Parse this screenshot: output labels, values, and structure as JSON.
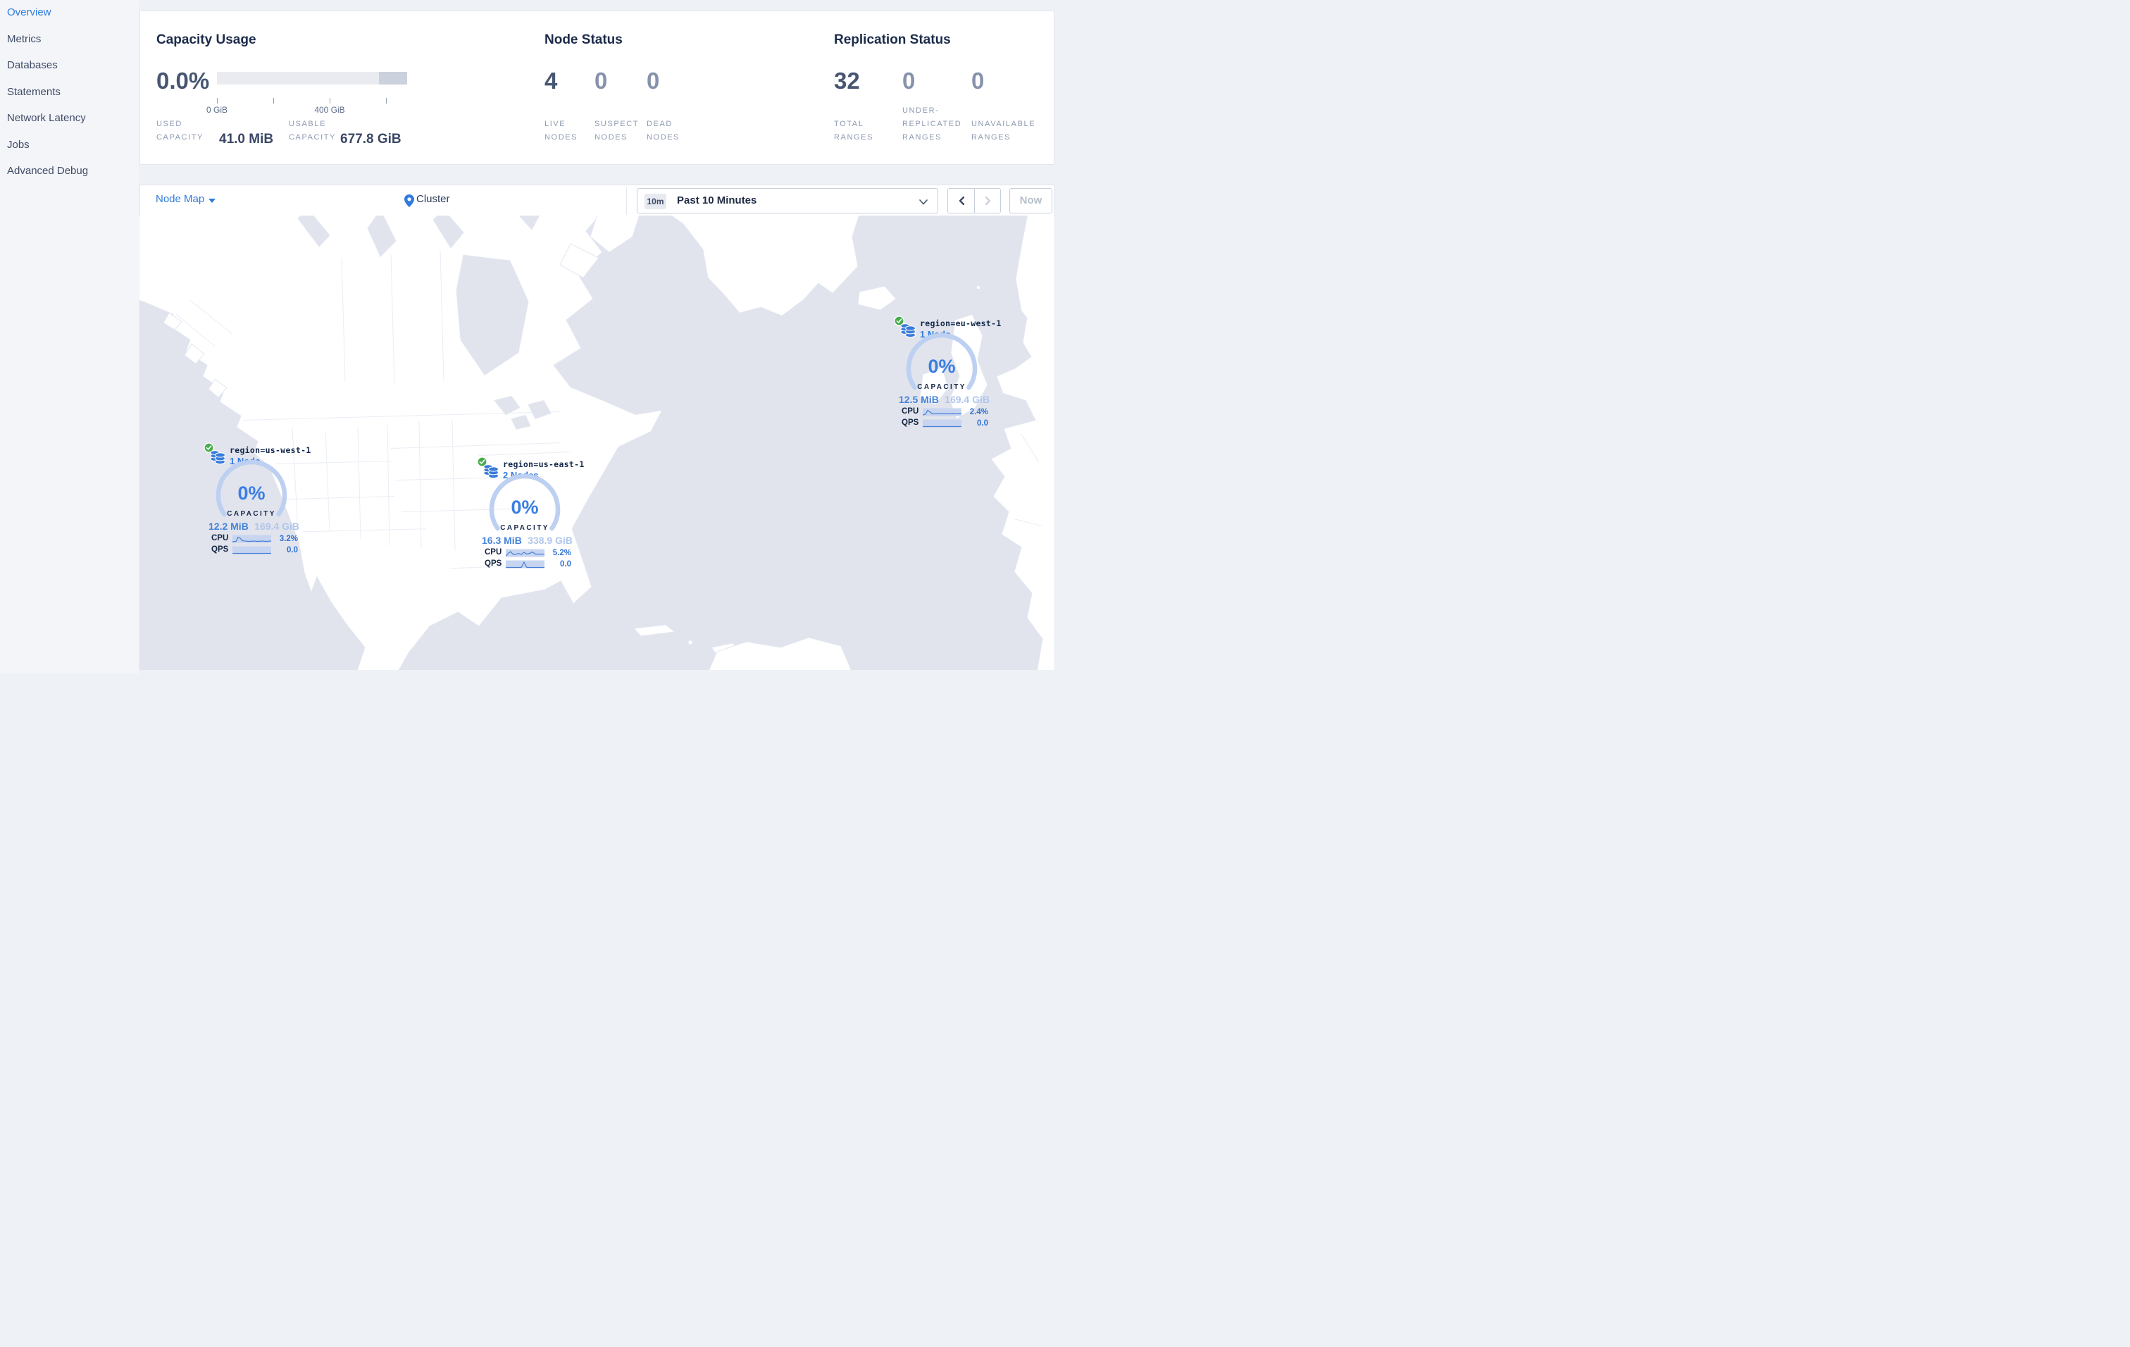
{
  "sidebar": {
    "items": [
      {
        "label": "Overview",
        "active": true
      },
      {
        "label": "Metrics"
      },
      {
        "label": "Databases"
      },
      {
        "label": "Statements"
      },
      {
        "label": "Network Latency"
      },
      {
        "label": "Jobs"
      },
      {
        "label": "Advanced Debug"
      }
    ]
  },
  "capacity": {
    "title": "Capacity Usage",
    "percent": "0.0%",
    "tick_start": "0 GiB",
    "tick_mid": "400 GiB",
    "used_label": "USED CAPACITY",
    "used_value": "41.0 MiB",
    "usable_label": "USABLE CAPACITY",
    "usable_value": "677.8 GiB"
  },
  "node_status": {
    "title": "Node Status",
    "live": {
      "value": "4",
      "label": "LIVE NODES"
    },
    "suspect": {
      "value": "0",
      "label": "SUSPECT NODES"
    },
    "dead": {
      "value": "0",
      "label": "DEAD NODES"
    }
  },
  "replication": {
    "title": "Replication Status",
    "total": {
      "value": "32",
      "label": "TOTAL RANGES"
    },
    "under": {
      "value": "0",
      "label": "UNDER-REPLICATED RANGES"
    },
    "unavailable": {
      "value": "0",
      "label": "UNAVAILABLE RANGES"
    }
  },
  "toolbar": {
    "view": "Node Map",
    "breadcrumb": "Cluster",
    "time_badge": "10m",
    "time_range": "Past 10 Minutes",
    "now": "Now"
  },
  "map": {
    "regions": [
      {
        "name": "region=us-west-1",
        "nodes": "1 Node",
        "percent": "0%",
        "capacity_label": "CAPACITY",
        "used": "12.2 MiB",
        "capacity": "169.4 GiB",
        "cpu_label": "CPU",
        "cpu": "3.2%",
        "qps_label": "QPS",
        "qps": "0.0"
      },
      {
        "name": "region=us-east-1",
        "nodes": "2 Nodes",
        "percent": "0%",
        "capacity_label": "CAPACITY",
        "used": "16.3 MiB",
        "capacity": "338.9 GiB",
        "cpu_label": "CPU",
        "cpu": "5.2%",
        "qps_label": "QPS",
        "qps": "0.0"
      },
      {
        "name": "region=eu-west-1",
        "nodes": "1 Node",
        "percent": "0%",
        "capacity_label": "CAPACITY",
        "used": "12.5 MiB",
        "capacity": "169.4 GiB",
        "cpu_label": "CPU",
        "cpu": "2.4%",
        "qps_label": "QPS",
        "qps": "0.0"
      }
    ]
  },
  "icons": {
    "caret-down": "filled triangle",
    "location-pin": "map pin",
    "chevron-down": "v",
    "chevron-left": "‹",
    "chevron-right": "›",
    "database-stack": "stacked cylinders",
    "check-circle": "green check"
  },
  "colors": {
    "accent_blue": "#2e7cdf",
    "ocean": "#e1e4ed",
    "land": "#ffffff",
    "ok_green": "#47ad4c",
    "gauge_arc": "#bdd0f1"
  }
}
